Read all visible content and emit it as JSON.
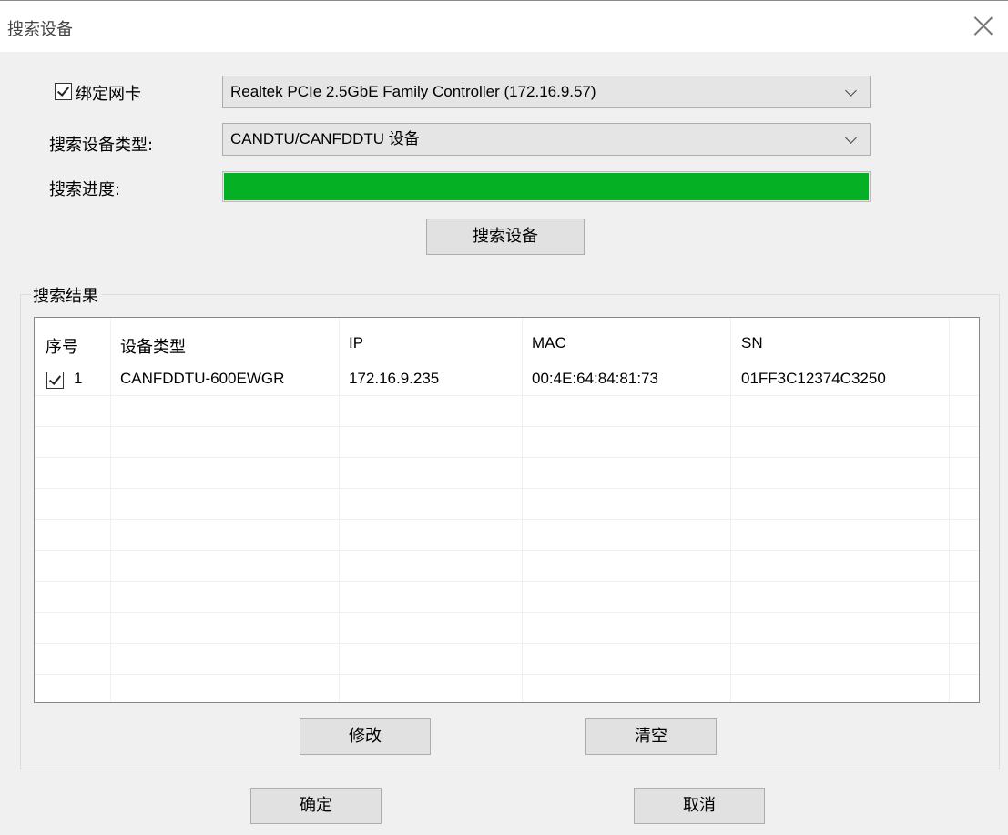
{
  "window": {
    "title": "搜索设备"
  },
  "form": {
    "bind_nic_label": "绑定网卡",
    "bind_nic_checked": true,
    "nic_value": "Realtek PCIe 2.5GbE Family Controller (172.16.9.57)",
    "device_type_label": "搜索设备类型:",
    "device_type_value": "CANDTU/CANFDDTU 设备",
    "progress_label": "搜索进度:",
    "progress_percent": 100,
    "progress_color": "#06b025",
    "search_button": "搜索设备"
  },
  "results": {
    "group_label": "搜索结果",
    "columns": [
      "序号",
      "设备类型",
      "IP",
      "MAC",
      "SN"
    ],
    "rows": [
      {
        "checked": true,
        "index": "1",
        "type": "CANFDDTU-600EWGR",
        "ip": "172.16.9.235",
        "mac": "00:4E:64:84:81:73",
        "sn": "01FF3C12374C3250"
      }
    ],
    "modify_button": "修改",
    "clear_button": "清空"
  },
  "footer": {
    "ok_button": "确定",
    "cancel_button": "取消"
  }
}
